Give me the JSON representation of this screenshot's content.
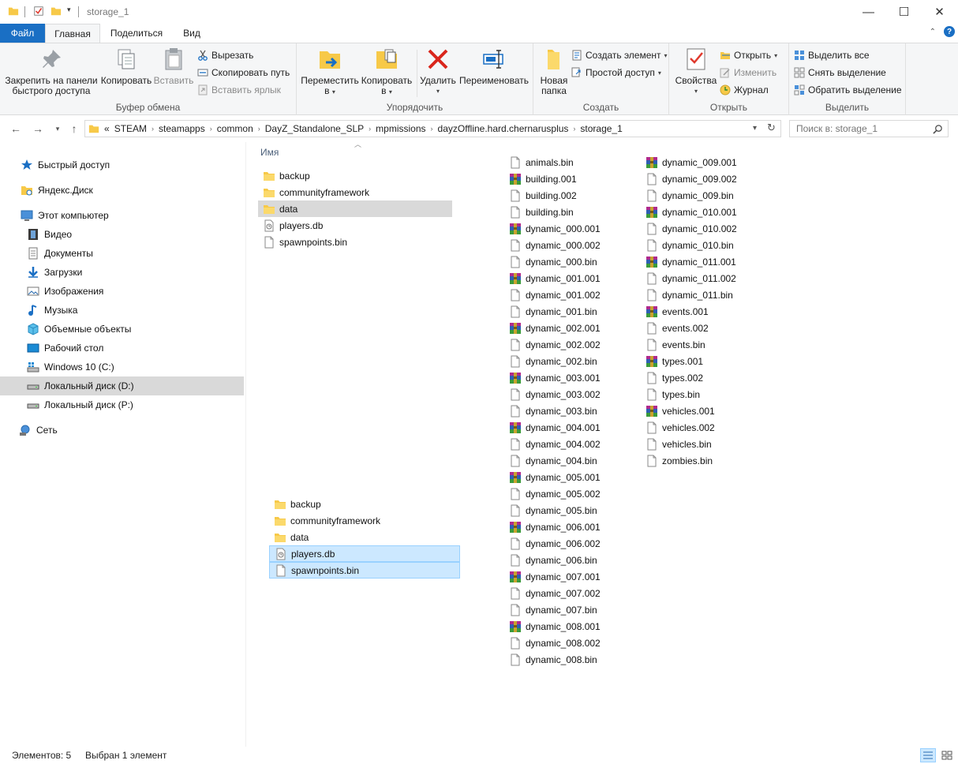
{
  "window": {
    "title": "storage_1",
    "minimize": "—",
    "maximize": "☐",
    "close": "✕"
  },
  "tabs": {
    "file": "Файл",
    "home": "Главная",
    "share": "Поделиться",
    "view": "Вид"
  },
  "ribbon": {
    "clipboard": {
      "label": "Буфер обмена",
      "pin": "Закрепить на панели быстрого доступа",
      "pin_l1": "Закрепить на панели",
      "pin_l2": "быстрого доступа",
      "copy": "Копировать",
      "paste": "Вставить",
      "cut": "Вырезать",
      "copy_path": "Скопировать путь",
      "paste_shortcut": "Вставить ярлык"
    },
    "organize": {
      "label": "Упорядочить",
      "move_l1": "Переместить",
      "move_l2": "в",
      "copy_l1": "Копировать",
      "copy_l2": "в",
      "delete": "Удалить",
      "rename": "Переименовать"
    },
    "new": {
      "label": "Создать",
      "folder_l1": "Новая",
      "folder_l2": "папка",
      "new_item": "Создать элемент",
      "easy_access": "Простой доступ"
    },
    "open": {
      "label": "Открыть",
      "properties": "Свойства",
      "open": "Открыть",
      "edit": "Изменить",
      "history": "Журнал"
    },
    "select": {
      "label": "Выделить",
      "select_all": "Выделить все",
      "select_none": "Снять выделение",
      "invert": "Обратить выделение"
    }
  },
  "address": {
    "overflow": "«",
    "crumbs": [
      "STEAM",
      "steamapps",
      "common",
      "DayZ_Standalone_SLP",
      "mpmissions",
      "dayzOffline.hard.chernarusplus",
      "storage_1"
    ],
    "search_placeholder": "Поиск в: storage_1"
  },
  "nav": {
    "quick_access": "Быстрый доступ",
    "yandex": "Яндекс.Диск",
    "this_pc": "Этот компьютер",
    "video": "Видео",
    "documents": "Документы",
    "downloads": "Загрузки",
    "pictures": "Изображения",
    "music": "Музыка",
    "objects3d": "Объемные объекты",
    "desktop": "Рабочий стол",
    "drive_c": "Windows 10 (C:)",
    "drive_d": "Локальный диск (D:)",
    "drive_p": "Локальный диск (P:)",
    "network": "Сеть"
  },
  "content": {
    "column_name": "Имя",
    "main_list": [
      "backup",
      "communityframework",
      "data",
      "players.db",
      "spawnpoints.bin"
    ],
    "files_col1": [
      "animals.bin",
      "building.001",
      "building.002",
      "building.bin",
      "dynamic_000.001",
      "dynamic_000.002",
      "dynamic_000.bin",
      "dynamic_001.001",
      "dynamic_001.002",
      "dynamic_001.bin",
      "dynamic_002.001",
      "dynamic_002.002",
      "dynamic_002.bin",
      "dynamic_003.001",
      "dynamic_003.002",
      "dynamic_003.bin",
      "dynamic_004.001",
      "dynamic_004.002",
      "dynamic_004.bin",
      "dynamic_005.001",
      "dynamic_005.002",
      "dynamic_005.bin",
      "dynamic_006.001",
      "dynamic_006.002",
      "dynamic_006.bin",
      "dynamic_007.001",
      "dynamic_007.002",
      "dynamic_007.bin",
      "dynamic_008.001",
      "dynamic_008.002",
      "dynamic_008.bin"
    ],
    "files_col2": [
      "dynamic_009.001",
      "dynamic_009.002",
      "dynamic_009.bin",
      "dynamic_010.001",
      "dynamic_010.002",
      "dynamic_010.bin",
      "dynamic_011.001",
      "dynamic_011.002",
      "dynamic_011.bin",
      "events.001",
      "events.002",
      "events.bin",
      "types.001",
      "types.002",
      "types.bin",
      "vehicles.001",
      "vehicles.002",
      "vehicles.bin",
      "zombies.bin"
    ],
    "drag_list": [
      "backup",
      "communityframework",
      "data",
      "players.db",
      "spawnpoints.bin"
    ]
  },
  "status": {
    "items": "Элементов: 5",
    "selected": "Выбран 1 элемент"
  },
  "colors": {
    "accent": "#1a6fc4",
    "folder": "#f7c948",
    "selection": "#cce8ff",
    "hover": "#d9d9d9"
  }
}
